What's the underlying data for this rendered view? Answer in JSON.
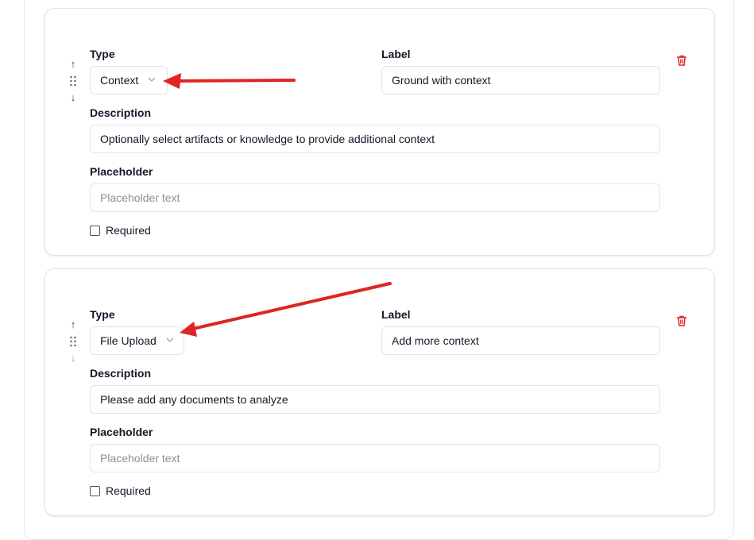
{
  "fields": [
    {
      "type_label": "Type",
      "type_value": "Context",
      "label_heading": "Label",
      "label_value": "Ground with context",
      "description_heading": "Description",
      "description_value": "Optionally select artifacts or knowledge to provide additional context",
      "placeholder_heading": "Placeholder",
      "placeholder_hint": "Placeholder text",
      "required_label": "Required",
      "move_up_glyph": "↑",
      "move_down_glyph": "↓"
    },
    {
      "type_label": "Type",
      "type_value": "File Upload",
      "label_heading": "Label",
      "label_value": "Add more context",
      "description_heading": "Description",
      "description_value": "Please add any documents to analyze",
      "placeholder_heading": "Placeholder",
      "placeholder_hint": "Placeholder text",
      "required_label": "Required",
      "move_up_glyph": "↑",
      "move_down_glyph": "↓"
    }
  ],
  "icons": {
    "move_up": "arrow-up-icon",
    "move_down": "arrow-down-icon",
    "drag": "grip-vertical-icon",
    "dropdown": "chevron-down-icon",
    "delete": "trash-icon"
  },
  "colors": {
    "annotation_arrow": "#e02424",
    "delete_icon": "#dc2626",
    "border": "#e2e4e8",
    "placeholder_text": "#8a8f98"
  }
}
